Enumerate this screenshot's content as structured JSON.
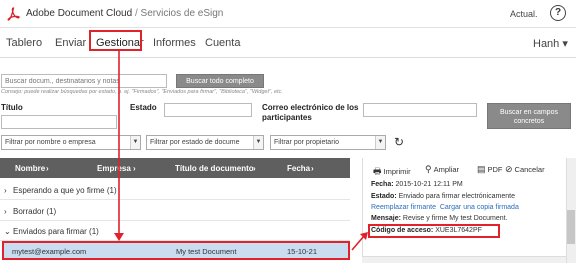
{
  "header": {
    "brand": "Adobe Document Cloud",
    "separator": "/",
    "subtitle": "Servicios de eSign",
    "status": "Actual.",
    "help_icon": "?"
  },
  "nav": {
    "items": [
      "Tablero",
      "Enviar",
      "Gestionar",
      "Informes",
      "Cuenta"
    ],
    "active": "Gestionar",
    "user_menu": "Hanh ▾"
  },
  "search": {
    "placeholder": "Buscar docum., destinatarios y notas",
    "button": "Buscar todo completo",
    "hint": "Consejo: puede realizar búsquedas por estado, p. ej. \"Firmados\", \"Enviados para firmar\", \"Biblioteca\", \"Widget\", etc."
  },
  "fields": {
    "title_label": "Título",
    "status_label": "Estado",
    "email_label": "Correo electrónico de los participantes",
    "concrete_button": "Buscar en campos concretos"
  },
  "filters": [
    "Filtrar por nombre o empresa",
    "Filtrar por estado de docume",
    "Filtrar por propietario"
  ],
  "table": {
    "columns": [
      "Nombre",
      "Empresa",
      "Título de documento",
      "Fecha"
    ],
    "groups": [
      "Esperando a que yo firme (1)",
      "Borrador (1)",
      "Enviados para firmar (1)"
    ],
    "row": {
      "name": "mytest@example.com",
      "title": "My test Document",
      "date": "15-10-21"
    }
  },
  "detail": {
    "toolbar": [
      "Imprimir",
      "Ampliar",
      "PDF",
      "Cancelar"
    ],
    "fecha_label": "Fecha:",
    "fecha_value": "2015-10-21 12:11 PM",
    "estado_label": "Estado:",
    "estado_value": "Enviado para firmar electrónicamente",
    "replace_link": "Reemplazar firmante",
    "copy_link": "Cargar una copia firmada",
    "message_label": "Mensaje:",
    "message_value": "Revise y firme My test Document.",
    "code_label": "Código de acceso:",
    "code_value": "XUE3L7642PF"
  },
  "colors": {
    "accent_red": "#e0222a",
    "link_blue": "#2a6ebb",
    "row_highlight": "#c9dcf0",
    "header_dark": "#5f5f5f"
  }
}
